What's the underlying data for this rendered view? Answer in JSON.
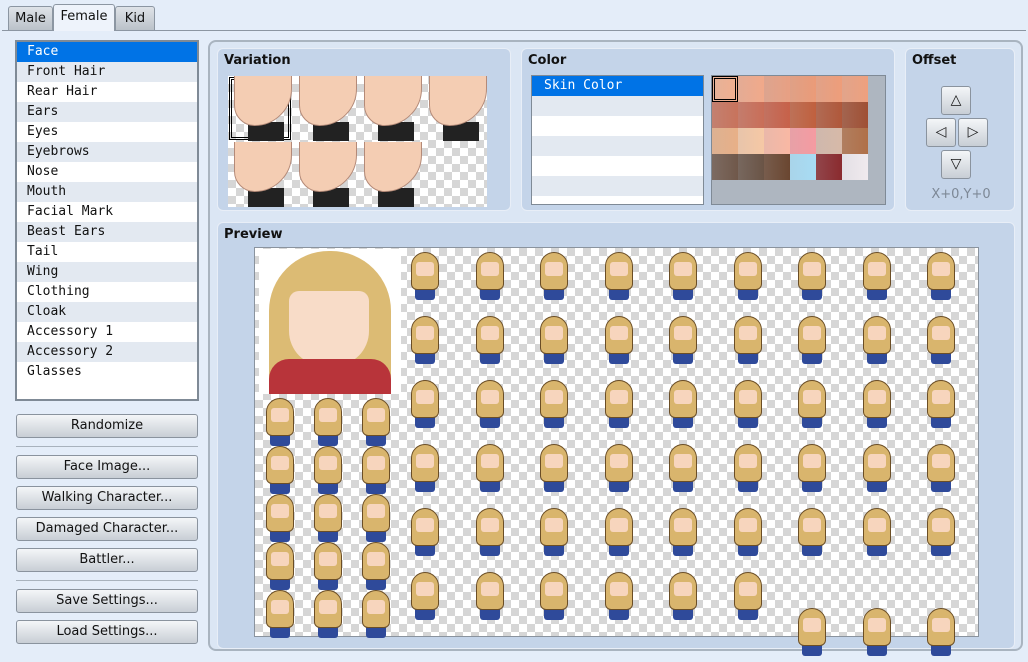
{
  "tabs": [
    {
      "label": "Male"
    },
    {
      "label": "Female",
      "active": true
    },
    {
      "label": "Kid"
    }
  ],
  "parts": {
    "selected": "Face",
    "items": [
      "Face",
      "Front Hair",
      "Rear Hair",
      "Ears",
      "Eyes",
      "Eyebrows",
      "Nose",
      "Mouth",
      "Facial Mark",
      "Beast Ears",
      "Tail",
      "Wing",
      "Clothing",
      "Cloak",
      "Accessory 1",
      "Accessory 2",
      "Glasses"
    ]
  },
  "buttons": {
    "randomize": "Randomize",
    "face_image": "Face Image...",
    "walking": "Walking Character...",
    "damaged": "Damaged Character...",
    "battler": "Battler...",
    "save": "Save Settings...",
    "load": "Load Settings..."
  },
  "variation": {
    "title": "Variation",
    "selected_index": 0
  },
  "color": {
    "title": "Color",
    "items": [
      "Skin Color"
    ],
    "selected": "Skin Color",
    "palette": [
      [
        "#f2b08f",
        "#f1a98a",
        "#e8a083",
        "#eb9b78",
        "#ee9d7a",
        "#eea07e"
      ],
      [
        "#c8735c",
        "#c96e58",
        "#c76149",
        "#c0603e",
        "#b0583a",
        "#a05034"
      ],
      [
        "#e8b087",
        "#f6c8a5",
        "#f9b8a4",
        "#f59ba1",
        "#d7b9a8",
        "#b07048"
      ],
      [
        "#70584a",
        "#6a5446",
        "#6a4630",
        "#a8dcf4",
        "#8a2a2e",
        "#f0eaee"
      ]
    ],
    "selected_swatch": [
      0,
      0
    ]
  },
  "offset": {
    "title": "Offset",
    "up": "△",
    "left": "◁",
    "right": "▷",
    "down": "▽",
    "readout": "X+0,Y+0"
  },
  "preview": {
    "title": "Preview"
  }
}
